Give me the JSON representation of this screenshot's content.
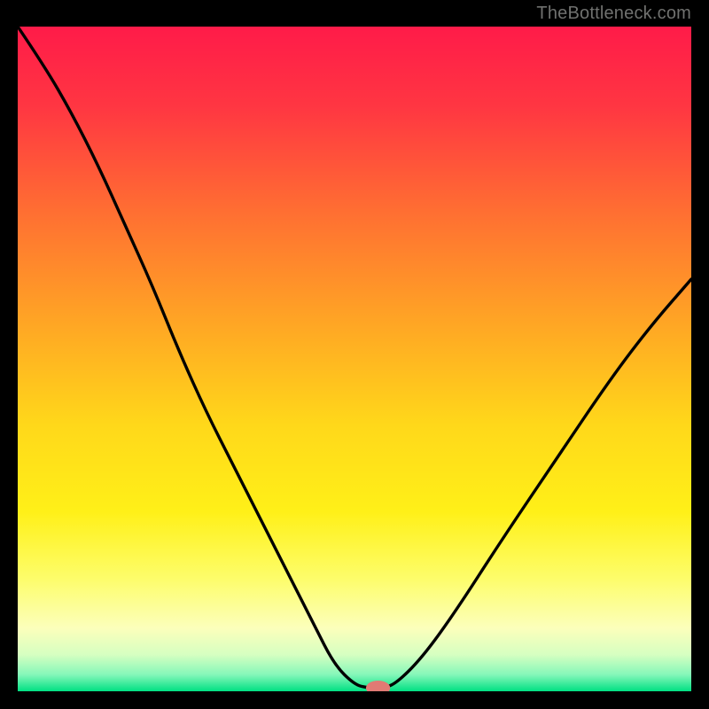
{
  "watermark": "TheBottleneck.com",
  "chart_data": {
    "type": "line",
    "title": "",
    "xlabel": "",
    "ylabel": "",
    "xlim": [
      0,
      100
    ],
    "ylim": [
      0,
      100
    ],
    "grid": false,
    "legend": false,
    "background_gradient": [
      {
        "offset": 0.0,
        "color": "#ff1b49"
      },
      {
        "offset": 0.12,
        "color": "#ff3642"
      },
      {
        "offset": 0.28,
        "color": "#ff6f32"
      },
      {
        "offset": 0.45,
        "color": "#ffa724"
      },
      {
        "offset": 0.6,
        "color": "#ffd81a"
      },
      {
        "offset": 0.73,
        "color": "#fff018"
      },
      {
        "offset": 0.83,
        "color": "#fdfd6a"
      },
      {
        "offset": 0.905,
        "color": "#fcffbb"
      },
      {
        "offset": 0.945,
        "color": "#d6ffc1"
      },
      {
        "offset": 0.975,
        "color": "#85f7b9"
      },
      {
        "offset": 1.0,
        "color": "#00e083"
      }
    ],
    "series": [
      {
        "name": "bottleneck-curve",
        "color": "#000000",
        "x": [
          0.0,
          4.0,
          8.0,
          12.0,
          16.0,
          20.0,
          24.0,
          28.0,
          32.0,
          36.0,
          40.0,
          44.0,
          47.0,
          50.0,
          52.0,
          54.0,
          56.0,
          60.0,
          65.0,
          72.0,
          80.0,
          88.0,
          94.0,
          100.0
        ],
        "y": [
          100.0,
          94.0,
          87.0,
          79.0,
          70.0,
          61.0,
          51.0,
          42.0,
          34.0,
          26.0,
          18.0,
          10.0,
          4.0,
          1.0,
          0.5,
          0.5,
          1.0,
          5.0,
          12.0,
          23.0,
          35.0,
          47.0,
          55.0,
          62.0
        ]
      }
    ],
    "marker": {
      "name": "target-marker",
      "x": 53.5,
      "y": 0.5,
      "color": "#e17a74",
      "rx": 1.8,
      "ry": 1.1
    }
  }
}
